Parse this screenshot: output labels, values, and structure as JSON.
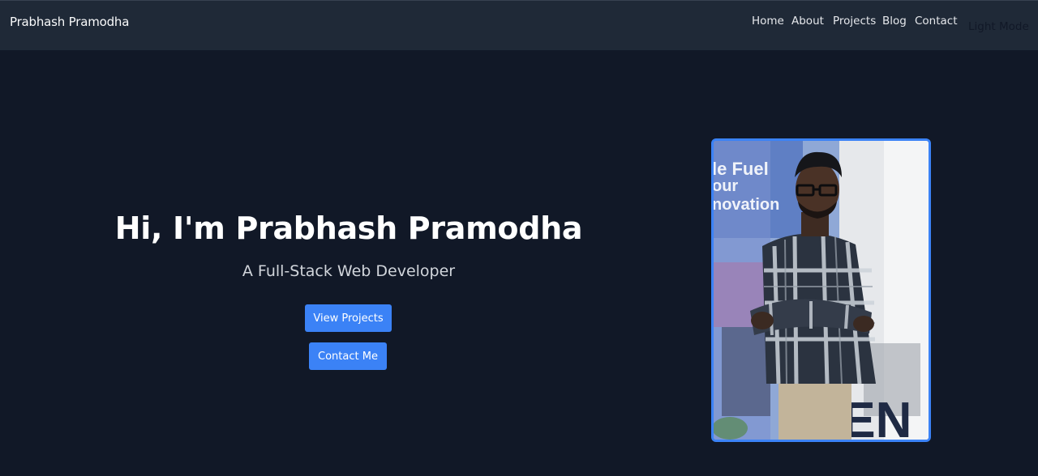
{
  "navbar": {
    "brand": "Prabhash Pramodha",
    "links": [
      {
        "label": "Home"
      },
      {
        "label": "About"
      },
      {
        "label": "Projects"
      },
      {
        "label": "Blog"
      },
      {
        "label": "Contact"
      }
    ],
    "mode_toggle": "Light Mode"
  },
  "hero": {
    "title": "Hi, I'm Prabhash Pramodha",
    "subtitle": "A Full-Stack Web Developer",
    "buttons": {
      "view_projects": "View Projects",
      "contact_me": "Contact Me"
    },
    "photo": {
      "description": "portrait-photo",
      "background_sign_text": [
        "le Fuel",
        "our",
        "novation"
      ],
      "floor_text": "OEN"
    }
  },
  "colors": {
    "page_bg": "#111827",
    "navbar_bg": "#1f2937",
    "accent": "#3b82f6"
  }
}
